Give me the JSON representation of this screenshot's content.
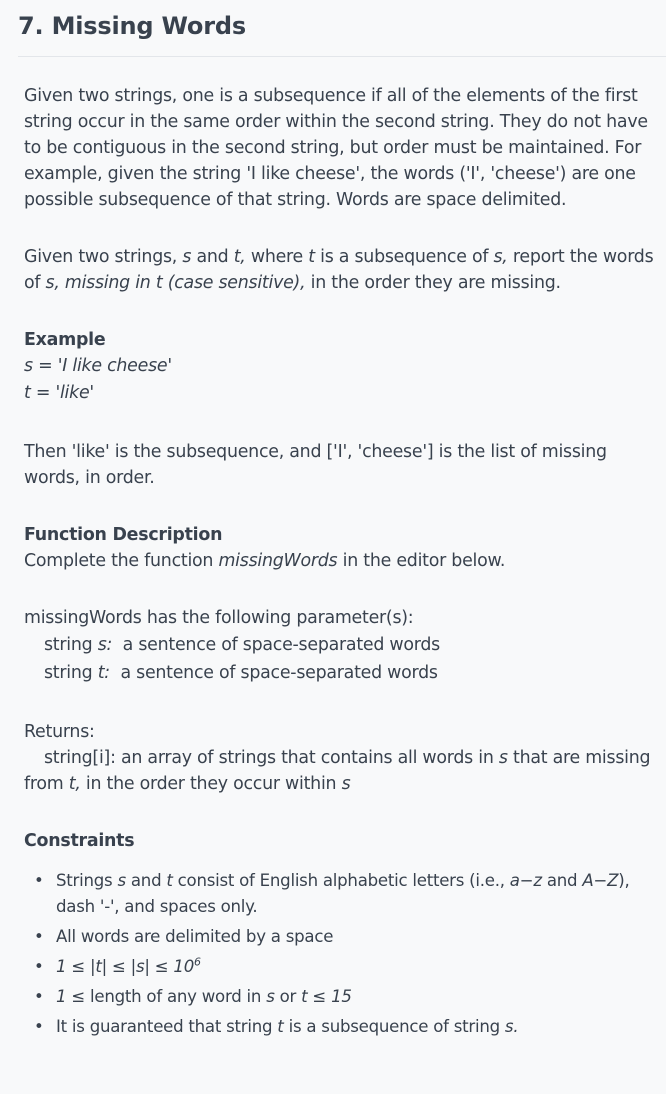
{
  "title": "7. Missing Words",
  "para1": "Given two strings, one is a subsequence if all of the elements of the first string occur in the same order within the second string. They do not have to be contiguous in the second string, but order must be maintained. For example, given the string 'I like cheese', the words ('I', 'cheese') are one possible subsequence of that string. Words are space delimited.",
  "para2": {
    "t1": "Given two strings, ",
    "s1": "s",
    "t2": " and ",
    "t3": "t,",
    "t4": " where ",
    "t5": "t",
    "t6": " is a subsequence of ",
    "s2": "s,",
    "t7": " report the words of ",
    "s3": "s, missing in t (case sensitive),",
    "t8": " in the order they are missing."
  },
  "example": {
    "heading": "Example",
    "s_line": "s = 'I like cheese'",
    "t_line": "t = 'like'",
    "explanation": "Then 'like' is the subsequence, and ['I', 'cheese'] is the list of missing words, in order."
  },
  "function_description": {
    "heading": "Function Description",
    "pre": "Complete the function ",
    "fn": "missingWords",
    "post": " in the editor below."
  },
  "parameters": {
    "intro": "missingWords has the following parameter(s):",
    "p1_type": "string ",
    "p1_name": "s:",
    "p1_desc": "  a sentence of space-separated words",
    "p2_type": "string ",
    "p2_name": "t:",
    "p2_desc": "  a sentence of space-separated words"
  },
  "returns": {
    "heading": "Returns:",
    "t1": "string[i]: an array of strings that contains all words in ",
    "s": "s",
    "t2": " that are missing from ",
    "t": "t,",
    "t3": " in the order they occur within ",
    "s_end": "s"
  },
  "constraints": {
    "heading": "Constraints",
    "item1": {
      "a": "Strings ",
      "s": "s",
      "b": " and ",
      "t": "t",
      "c": " consist of English alphabetic letters (i.e., ",
      "az": "a−z",
      "d": " and ",
      "AZ": "A−Z",
      "e": "), dash '-', and spaces only."
    },
    "item2": "All words are delimited by a space",
    "item3": {
      "a": "1 ≤ |t| ≤ |s| ≤ 10",
      "exp": "6"
    },
    "item4": {
      "a": "1",
      "b": " ≤ length of any word in ",
      "s": "s",
      "c": " or ",
      "t": "t",
      "d": " ≤ 15"
    },
    "item5": {
      "a": "It is guaranteed that string ",
      "t": "t",
      "b": " is a subsequence of string ",
      "s": "s."
    }
  }
}
